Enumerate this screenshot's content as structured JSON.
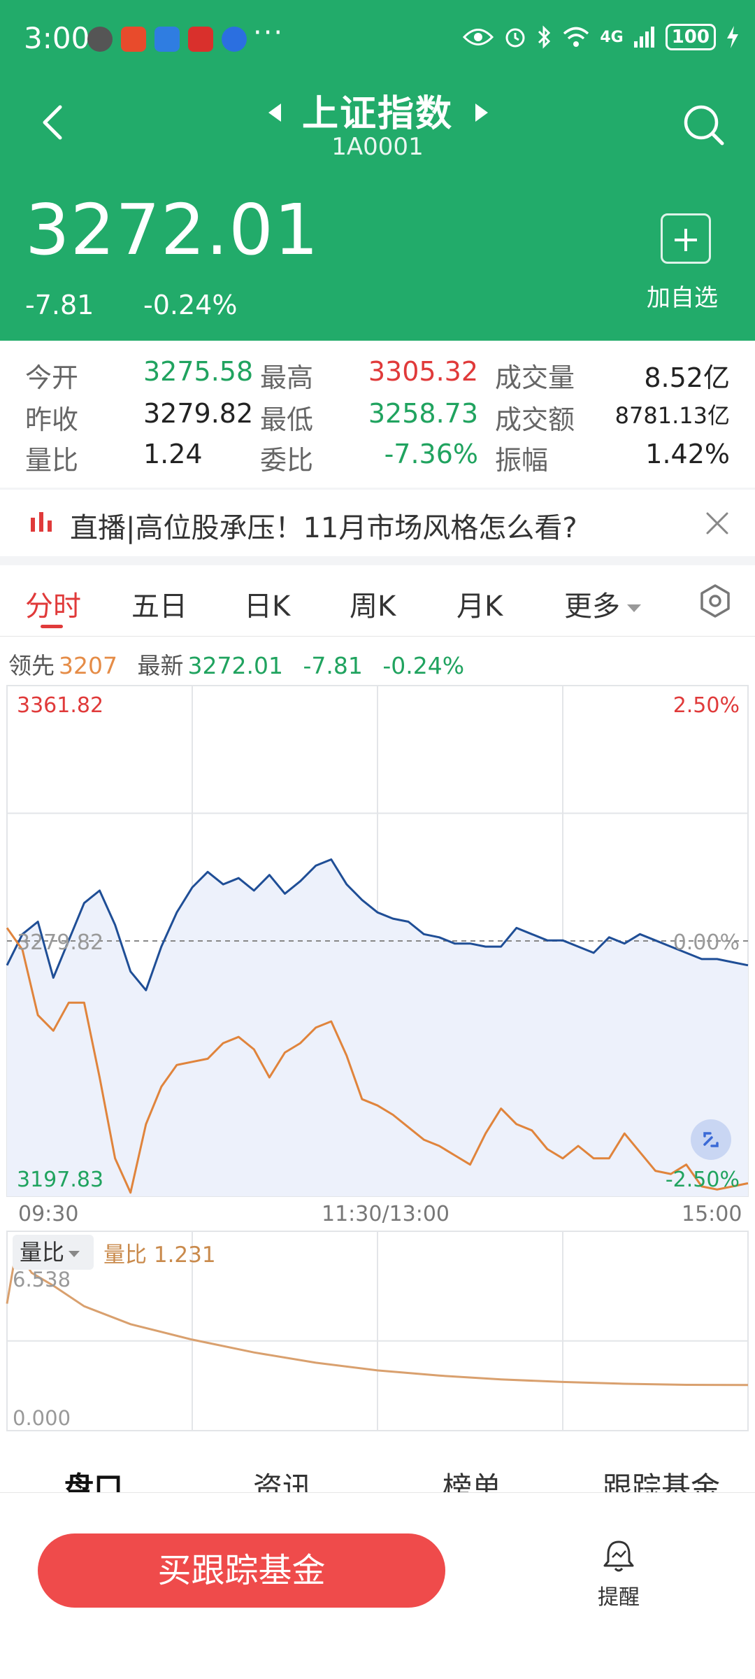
{
  "status_bar": {
    "time": "3:00",
    "more": "···",
    "network": "4G",
    "battery": "100"
  },
  "header": {
    "title": "上证指数",
    "code": "1A0001",
    "price": "3272.01",
    "change": "-7.81",
    "change_pct": "-0.24%",
    "add_label": "加自选"
  },
  "stats": [
    {
      "label": "今开",
      "value": "3275.58",
      "color": "green"
    },
    {
      "label": "最高",
      "value": "3305.32",
      "color": "red"
    },
    {
      "label": "成交量",
      "value": "8.52亿",
      "color": "dark"
    },
    {
      "label": "昨收",
      "value": "3279.82",
      "color": "dark"
    },
    {
      "label": "最低",
      "value": "3258.73",
      "color": "green"
    },
    {
      "label": "成交额",
      "value": "8781.13亿",
      "color": "dark"
    },
    {
      "label": "量比",
      "value": "1.24",
      "color": "dark"
    },
    {
      "label": "委比",
      "value": "-7.36%",
      "color": "green"
    },
    {
      "label": "振幅",
      "value": "1.42%",
      "color": "dark"
    }
  ],
  "banner": {
    "text": "直播|高位股承压！11月市场风格怎么看?"
  },
  "tabs": [
    {
      "label": "分时",
      "active": true
    },
    {
      "label": "五日"
    },
    {
      "label": "日K"
    },
    {
      "label": "周K"
    },
    {
      "label": "月K"
    },
    {
      "label": "更多"
    }
  ],
  "info": {
    "lead_label": "领先",
    "lead_value": "3207",
    "latest_label": "最新",
    "latest_value": "3272.01",
    "latest_change": "-7.81",
    "latest_pct": "-0.24%"
  },
  "chart_data": [
    {
      "type": "line",
      "x_ticks": [
        "09:30",
        "11:30/13:00",
        "15:00"
      ],
      "y_labels_left": [
        "3361.82",
        "3279.82",
        "3197.83"
      ],
      "y_labels_right": [
        "2.50%",
        "0.00%",
        "-2.50%"
      ],
      "ylim": [
        3197.83,
        3361.82
      ],
      "reference": 3279.82,
      "x": [
        0,
        5,
        10,
        15,
        20,
        25,
        30,
        35,
        40,
        45,
        50,
        55,
        60,
        65,
        70,
        75,
        80,
        85,
        90,
        95,
        100,
        105,
        110,
        115,
        120,
        125,
        130,
        135,
        140,
        145,
        150,
        155,
        160,
        165,
        170,
        175,
        180,
        185,
        190,
        195,
        200,
        205,
        210,
        215,
        220,
        225,
        230,
        235,
        240
      ],
      "series": [
        {
          "color": "#1f4e96",
          "values": [
            3272,
            3282,
            3286,
            3268,
            3280,
            3292,
            3296,
            3285,
            3270,
            3264,
            3278,
            3289,
            3297,
            3302,
            3298,
            3300,
            3296,
            3301,
            3295,
            3299,
            3304,
            3306,
            3298,
            3293,
            3289,
            3287,
            3286,
            3282,
            3281,
            3279,
            3279,
            3278,
            3278,
            3284,
            3282,
            3280,
            3280,
            3278,
            3276,
            3281,
            3279,
            3282,
            3280,
            3278,
            3276,
            3274,
            3274,
            3273,
            3272
          ]
        },
        {
          "color": "#e0843c",
          "values": [
            3284,
            3277,
            3256,
            3251,
            3260,
            3260,
            3236,
            3210,
            3199,
            3221,
            3233,
            3240,
            3241,
            3242,
            3247,
            3249,
            3245,
            3236,
            3244,
            3247,
            3252,
            3254,
            3243,
            3229,
            3227,
            3224,
            3220,
            3216,
            3214,
            3211,
            3208,
            3218,
            3226,
            3221,
            3219,
            3213,
            3210,
            3214,
            3210,
            3210,
            3218,
            3212,
            3206,
            3205,
            3208,
            3201,
            3200,
            3201,
            3202
          ]
        }
      ]
    },
    {
      "type": "line",
      "y_labels": [
        "6.538",
        "0.000"
      ],
      "ylim": [
        0,
        6.538
      ],
      "x": [
        0,
        3,
        8,
        15,
        25,
        40,
        60,
        80,
        100,
        120,
        140,
        160,
        180,
        200,
        220,
        240
      ],
      "series": [
        {
          "name": "量比",
          "color": "#d9a06e",
          "values": [
            4.4,
            6.5,
            5.6,
            5.1,
            4.3,
            3.6,
            3.0,
            2.5,
            2.1,
            1.8,
            1.6,
            1.45,
            1.35,
            1.28,
            1.24,
            1.23
          ]
        }
      ]
    }
  ],
  "volume": {
    "dropdown": "量比",
    "label": "量比 1.231"
  },
  "subtabs": [
    "盘口",
    "资讯",
    "榜单",
    "跟踪基金"
  ],
  "bottom": {
    "buy_label": "买跟踪基金",
    "remind_label": "提醒"
  }
}
